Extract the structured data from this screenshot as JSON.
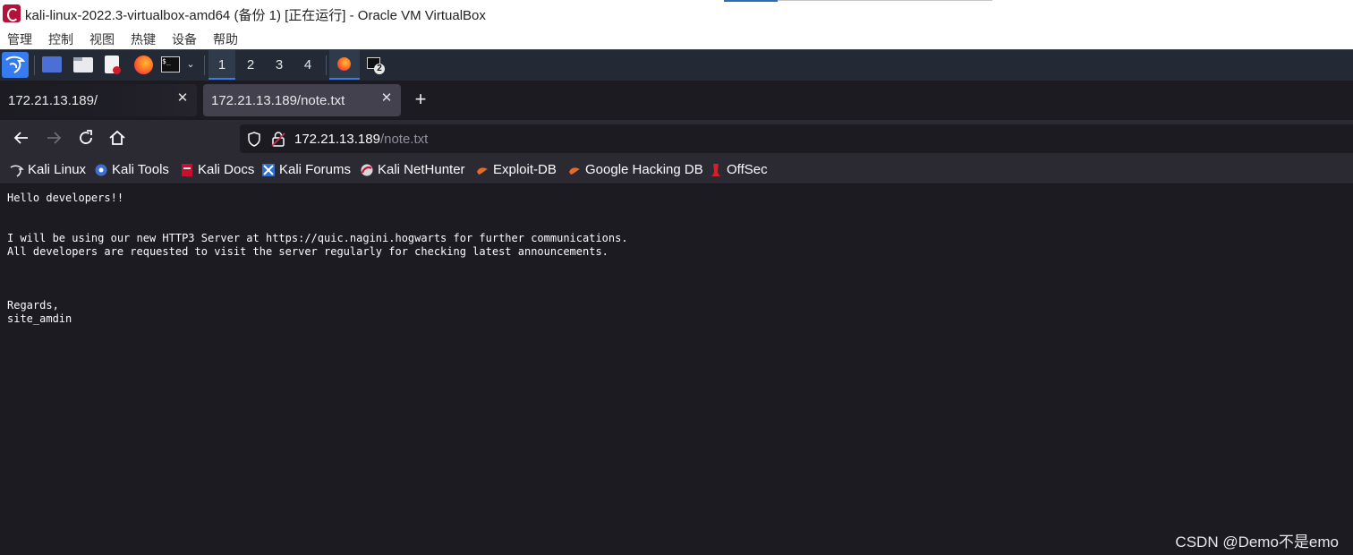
{
  "window": {
    "title": "kali-linux-2022.3-virtualbox-amd64 (备份 1) [正在运行] - Oracle VM VirtualBox",
    "menu": [
      "管理",
      "控制",
      "视图",
      "热键",
      "设备",
      "帮助"
    ]
  },
  "panel": {
    "workspaces": [
      "1",
      "2",
      "3",
      "4"
    ],
    "terminal_badge": "2",
    "icons": [
      "kali-menu-icon",
      "desktop-icon",
      "file-manager-icon",
      "text-editor-icon",
      "firefox-icon",
      "terminal-icon"
    ]
  },
  "browser": {
    "tabs": [
      {
        "label": "172.21.13.189/",
        "active": false
      },
      {
        "label": "172.21.13.189/note.txt",
        "active": true
      }
    ],
    "new_tab_label": "+",
    "url": {
      "host": "172.21.13.189",
      "path": "/note.txt"
    },
    "bookmarks": [
      {
        "label": "Kali Linux",
        "icon": "kali-dragon-icon"
      },
      {
        "label": "Kali Tools",
        "icon": "kali-tools-icon"
      },
      {
        "label": "Kali Docs",
        "icon": "kali-docs-icon"
      },
      {
        "label": "Kali Forums",
        "icon": "kali-forums-icon"
      },
      {
        "label": "Kali NetHunter",
        "icon": "nethunter-icon"
      },
      {
        "label": "Exploit-DB",
        "icon": "exploit-db-icon"
      },
      {
        "label": "Google Hacking DB",
        "icon": "ghdb-icon"
      },
      {
        "label": "OffSec",
        "icon": "offsec-icon"
      }
    ]
  },
  "page": {
    "text": "Hello developers!!\n\n\nI will be using our new HTTP3 Server at https://quic.nagini.hogwarts for further communications.\nAll developers are requested to visit the server regularly for checking latest announcements.\n\n\n\nRegards,\nsite_amdin"
  },
  "watermark": "CSDN @Demo不是emo",
  "colors": {
    "browser_bg": "#1c1b22",
    "toolbar_bg": "#2b2a33",
    "panel_bg": "#232a36",
    "accent_blue": "#367bf0"
  }
}
